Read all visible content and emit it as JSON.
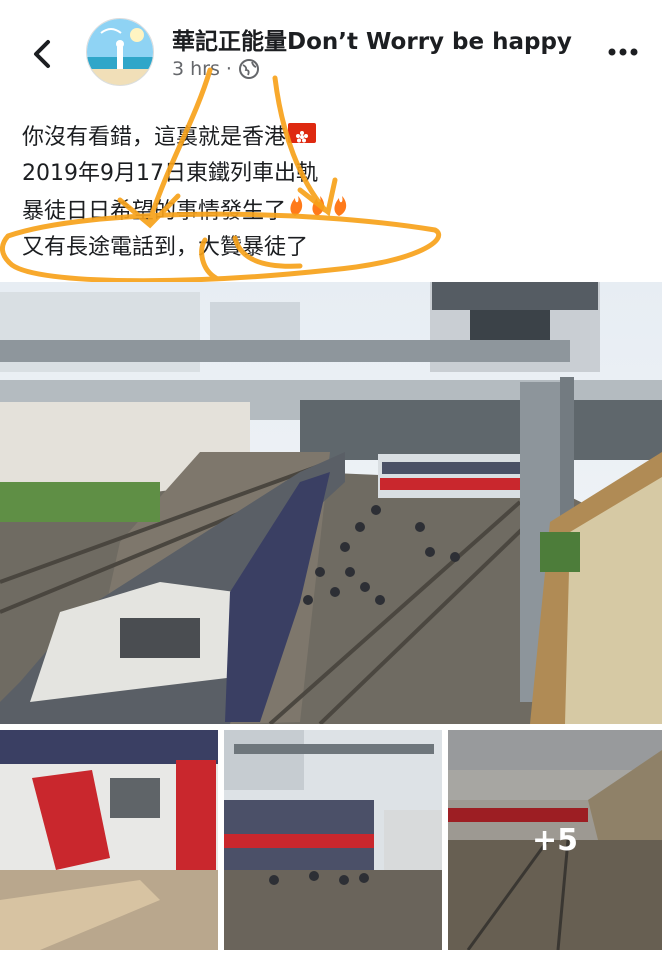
{
  "header": {
    "page_name": "華記正能量Don’t Worry be happy",
    "time": "3 hrs",
    "separator": "·",
    "icons": [
      "back-arrow-icon",
      "globe-icon",
      "more-dots-icon"
    ]
  },
  "post": {
    "lines": [
      "你沒有看錯，這裏就是香港",
      "2019年9月17日東鐵列車出軌",
      "暴徒日日希望的事情發生了",
      "又有長途電話到，大贊暴徒了"
    ],
    "emoji": [
      "hong-kong-flag",
      "fire",
      "fire",
      "fire"
    ],
    "annotation_color": "#f7a21b"
  },
  "photos": {
    "more_count": "+5"
  },
  "colors": {
    "text": "#1c1e21",
    "secondary": "#65676b",
    "annotation": "#f7a21b"
  }
}
